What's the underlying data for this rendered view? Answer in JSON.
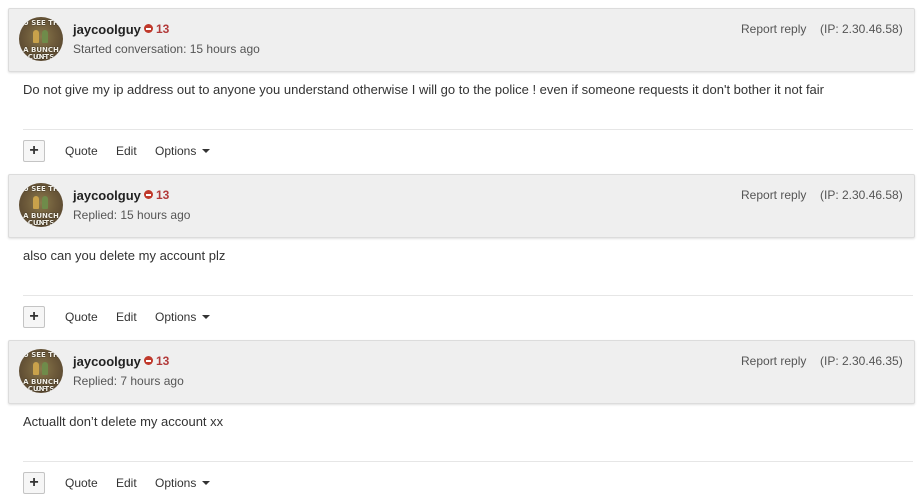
{
  "posts": [
    {
      "username": "jaycoolguy",
      "reputation": "13",
      "meta": "Started conversation: 15 hours ago",
      "report_label": "Report reply",
      "ip": "(IP: 2.30.46.58)",
      "body": "Do not give my ip address out to anyone you understand otherwise I will go to the police ! even if someone requests it don't bother it not fair",
      "avatar_caption_top": "U SEE TH",
      "avatar_caption_mid": "A BUNCH OF",
      "avatar_caption_bottom": "CUNTS"
    },
    {
      "username": "jaycoolguy",
      "reputation": "13",
      "meta": "Replied: 15 hours ago",
      "report_label": "Report reply",
      "ip": "(IP: 2.30.46.58)",
      "body": "also can you delete my account plz",
      "avatar_caption_top": "U SEE TH",
      "avatar_caption_mid": "A BUNCH OF",
      "avatar_caption_bottom": "CUNTS"
    },
    {
      "username": "jaycoolguy",
      "reputation": "13",
      "meta": "Replied: 7 hours ago",
      "report_label": "Report reply",
      "ip": "(IP: 2.30.46.35)",
      "body": "Actuallt don’t delete my account xx",
      "avatar_caption_top": "U SEE TH",
      "avatar_caption_mid": "A BUNCH OF",
      "avatar_caption_bottom": "CUNTS"
    }
  ],
  "actions": {
    "plus_label": "+",
    "quote_label": "Quote",
    "edit_label": "Edit",
    "options_label": "Options"
  },
  "icons": {
    "reputation": "minus-circle-icon",
    "options": "caret-down-icon",
    "plus": "plus-icon"
  },
  "colors": {
    "reputation_negative": "#b23a3a",
    "header_background": "#efefef"
  }
}
